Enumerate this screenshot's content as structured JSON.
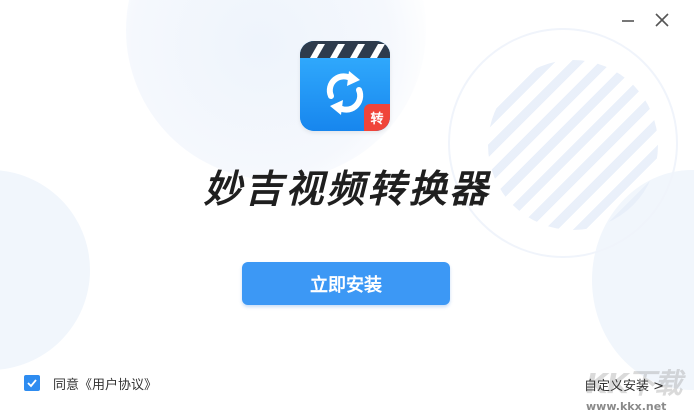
{
  "window": {
    "minimize_icon": "minimize-icon",
    "close_icon": "close-icon"
  },
  "app": {
    "icon": "video-convert-app-icon",
    "badge": "转",
    "title": "妙吉视频转换器"
  },
  "install_button": {
    "label": "立即安装"
  },
  "agreement": {
    "checked": true,
    "prefix": "同意",
    "link": "《用户协议》"
  },
  "custom_install": {
    "label": "自定义安装 >"
  },
  "watermark": {
    "text": "KK下载",
    "url": "www.kkx.net"
  },
  "colors": {
    "accent": "#3c98f5",
    "badge": "#f0453a",
    "title": "#1f1f1f"
  }
}
